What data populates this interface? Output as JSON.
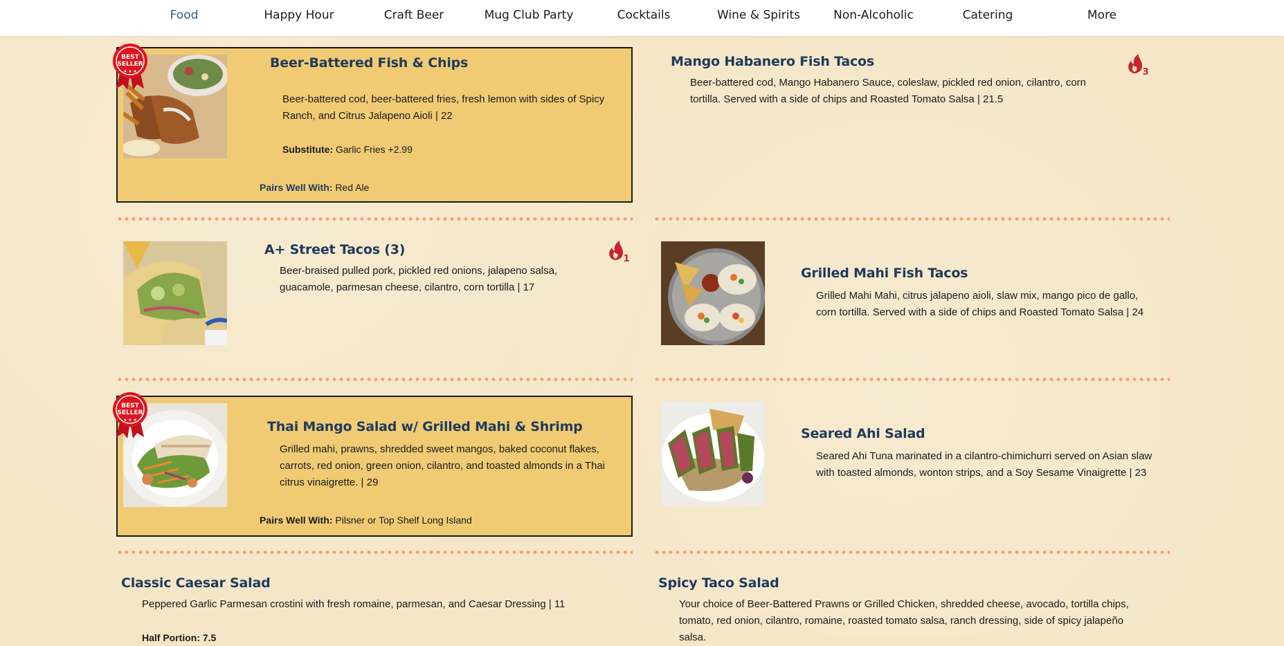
{
  "nav": {
    "items": [
      "Food",
      "Happy Hour",
      "Craft Beer",
      "Mug Club Party",
      "Cocktails",
      "Wine & Spirits",
      "Non-Alcoholic",
      "Catering",
      "More"
    ],
    "active": "Food"
  },
  "labels": {
    "pairs_well_with": "Pairs Well With:",
    "substitute": "Substitute:",
    "best_seller_line1": "BEST",
    "best_seller_line2": "SELLER"
  },
  "menu": {
    "fish_chips": {
      "title": "Beer-Battered Fish & Chips",
      "description": "Beer-battered cod, beer-battered fries, fresh lemon with sides of Spicy Ranch, and Citrus Jalapeno Aioli  |  22",
      "substitute": "Garlic Fries +2.99",
      "pairs": "Red Ale",
      "badge": "best-seller"
    },
    "mango_tacos": {
      "title": "Mango Habanero Fish Tacos",
      "description": "Beer-battered cod, Mango Habanero Sauce, coleslaw, pickled red onion, cilantro, corn tortilla. Served with a side of chips and Roasted Tomato Salsa  |  21.5",
      "spice_level": "3"
    },
    "street_tacos": {
      "title": "A+ Street Tacos (3)",
      "description": "Beer-braised pulled pork, pickled red onions, jalapeno salsa, guacamole, parmesan cheese, cilantro, corn tortilla  |  17",
      "spice_level": "1"
    },
    "mahi_tacos": {
      "title": "Grilled Mahi Fish Tacos",
      "description": "Grilled Mahi Mahi, citrus jalapeno aioli, slaw mix, mango pico de gallo, corn tortilla. Served with a side of chips and Roasted Tomato Salsa | 24"
    },
    "thai_salad": {
      "title": "Thai Mango Salad w/ Grilled Mahi & Shrimp",
      "description": "Grilled mahi, prawns, shredded sweet mangos, baked coconut flakes, carrots, red onion, green onion, cilantro, and toasted almonds in a Thai citrus vinaigrette. | 29",
      "pairs": "Pilsner or Top Shelf Long Island",
      "badge": "best-seller"
    },
    "ahi_salad": {
      "title": "Seared Ahi Salad",
      "description": "Seared Ahi Tuna marinated in a cilantro-chimichurri served on Asian slaw with toasted almonds, wonton strips, and a Soy Sesame Vinaigrette |  23"
    },
    "caesar": {
      "title": "Classic Caesar Salad",
      "description": "Peppered Garlic Parmesan crostini with fresh romaine, parmesan, and Caesar Dressing  |  11",
      "half_portion": "Half Portion: 7.5"
    },
    "taco_salad": {
      "title": "Spicy Taco Salad",
      "description": "Your choice of Beer-Battered Prawns or Grilled Chicken, shredded cheese, avocado, tortilla chips, tomato, red onion, cilantro, romaine, roasted tomato salsa, ranch dressing, side of spicy jalapeño salsa."
    }
  },
  "colors": {
    "accent_blue": "#1f3a5b",
    "featured_bg": "#f0cb74",
    "dot_divider": "#f0a374",
    "spice_red": "#c8242b",
    "badge_red": "#e0141f"
  }
}
